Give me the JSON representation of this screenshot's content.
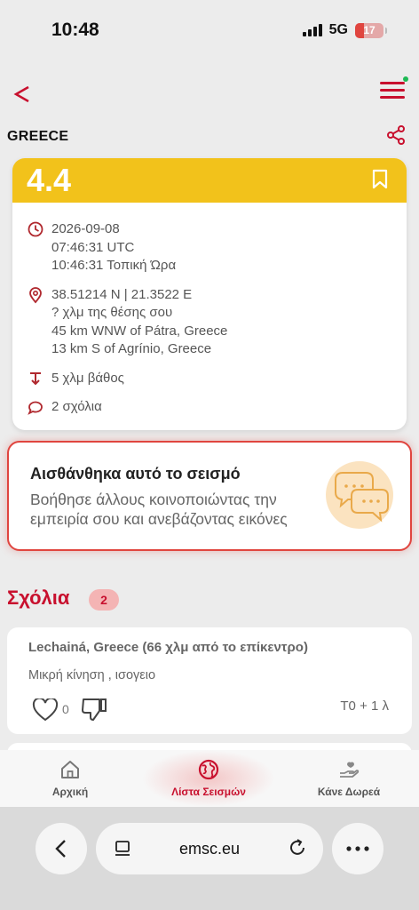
{
  "status": {
    "time": "10:48",
    "network": "5G",
    "battery": "17"
  },
  "header": {
    "region": "GREECE"
  },
  "event": {
    "magnitude": "4.4",
    "date": "2026-09-08",
    "utc_time": "07:46:31 UTC",
    "local_time": "10:46:31 Τοπική Ώρα",
    "coordinates": "38.51214 N | 21.3522 E",
    "distance_you": "? χλμ της θέσης σου",
    "near_1": "45 km WNW of Pátra, Greece",
    "near_2": "13 km S of Agrínio, Greece",
    "depth": "5 χλμ βάθος",
    "comments_count": "2 σχόλια"
  },
  "felt": {
    "title": "Αισθάνθηκα αυτό το σεισμό",
    "description": "Βοήθησε άλλους κοινοποιώντας την εμπειρία σου και ανεβάζοντας εικόνες"
  },
  "comments": {
    "heading": "Σχόλια",
    "badge": "2",
    "items": [
      {
        "location": "Lechainá, Greece (66 χλμ από το επίκεντρο)",
        "text": "Μικρή κίνηση , ισογειο",
        "likes": "0",
        "time": "T0 + 1 λ"
      }
    ]
  },
  "bottom_nav": {
    "home": "Αρχική",
    "list": "Λίστα Σεισμών",
    "donate": "Κάνε Δωρεά"
  },
  "browser": {
    "url": "emsc.eu"
  },
  "colors": {
    "accent": "#c8102e",
    "magnitude_bar": "#f2c21b",
    "felt_border": "#e0453f"
  }
}
